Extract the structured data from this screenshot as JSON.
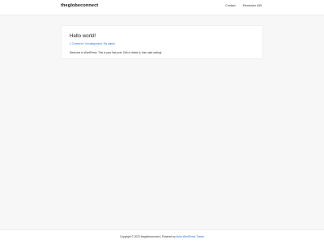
{
  "header": {
    "site_title": "theglobeconnect",
    "nav": [
      {
        "label": "Contact"
      },
      {
        "label": "Elementor #35"
      }
    ]
  },
  "post": {
    "title": "Hello world!",
    "meta": {
      "comments": "1 Comment",
      "category": "Uncategorized",
      "author": "By admin",
      "separator": "/"
    },
    "excerpt": "Welcome to WordPress. This is your first post. Edit or delete it, then start writing!"
  },
  "footer": {
    "prefix": "Copyright © 2023 theglobeconnect | Powered by ",
    "theme_link": "Astra WordPress Theme"
  }
}
